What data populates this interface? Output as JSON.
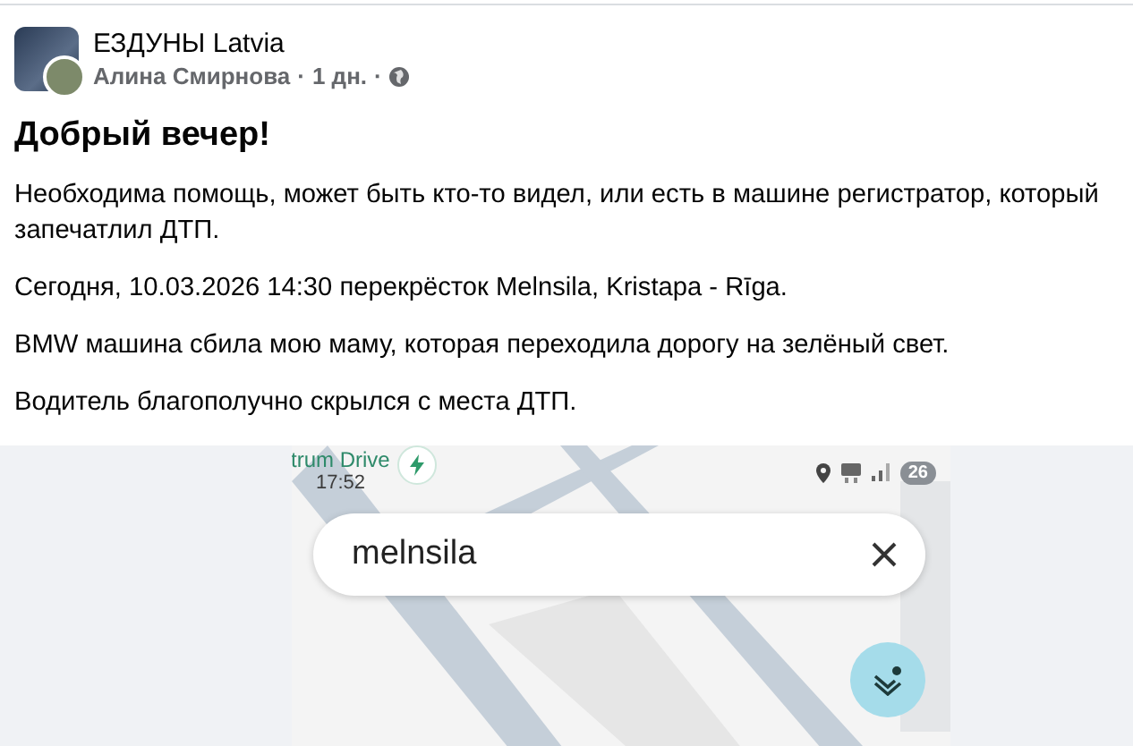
{
  "group": {
    "name": "ЕЗДУНЫ Latvia"
  },
  "meta": {
    "author": "Алина Смирнова",
    "separator": "·",
    "time": "1 дн."
  },
  "title": "Добрый вечер!",
  "paragraphs": [
    "Необходима помощь, может быть кто-то видел, или есть в машине регистратор, который запечатлил ДТП.",
    "Сегодня, 10.03.2026 14:30 перекрёсток Melnsila, Kristapa - Rīga.",
    "BMW машина сбила мою маму, которая переходила дорогу на зелёный свет.",
    "Водитель благополучно скрылся с места ДТП."
  ],
  "phone_screenshot": {
    "place_label": "trum Drive",
    "clock": "17:52",
    "battery": "26",
    "search": {
      "value": "melnsila"
    }
  }
}
